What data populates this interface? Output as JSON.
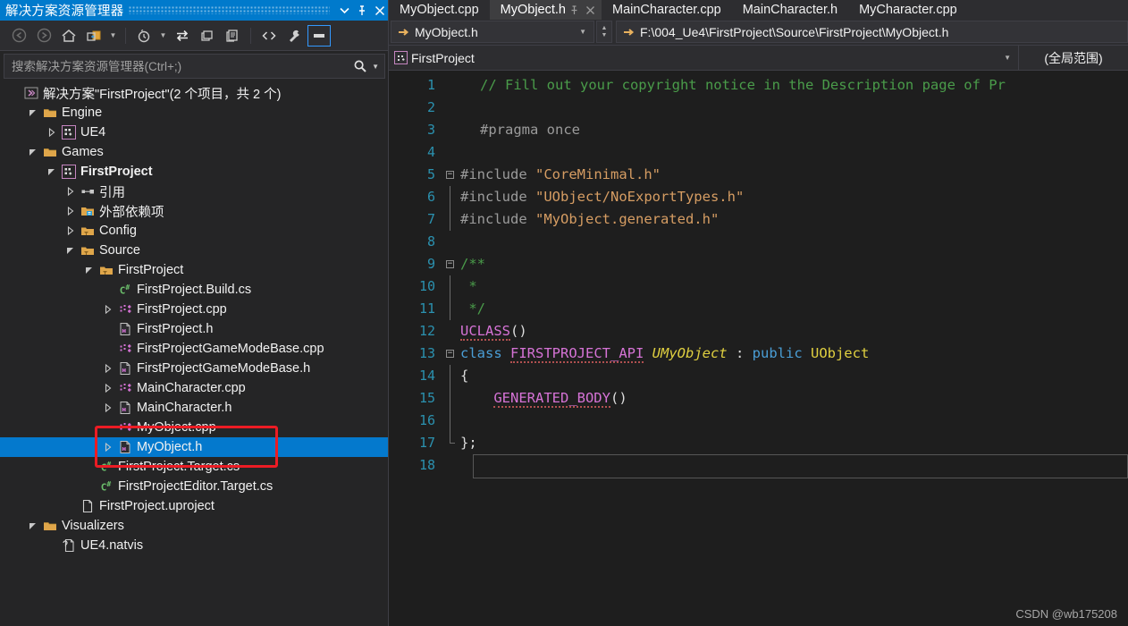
{
  "solution_explorer": {
    "title": "解决方案资源管理器",
    "titlebar_buttons": [
      {
        "name": "dropdown",
        "glyph": "▼"
      },
      {
        "name": "pin",
        "glyph": "⚲"
      },
      {
        "name": "close",
        "glyph": "✕"
      }
    ],
    "toolbar": [
      {
        "name": "back",
        "label": "后退",
        "icon": "back-arrow-icon",
        "disabled": true
      },
      {
        "name": "forward",
        "label": "前进",
        "icon": "forward-arrow-icon",
        "disabled": true
      },
      {
        "name": "home",
        "label": "主页",
        "icon": "home-icon",
        "disabled": false
      },
      {
        "name": "new-folder",
        "label": "新建文件夹",
        "icon": "new-folder-icon",
        "disabled": false
      },
      {
        "name": "pending-changes",
        "label": "挂起的更改筛选器",
        "icon": "clock-filter-icon",
        "disabled": false
      },
      {
        "name": "sync",
        "label": "与活动文档同步",
        "icon": "sync-icon",
        "disabled": false
      },
      {
        "name": "refresh",
        "label": "刷新",
        "icon": "refresh-icon",
        "disabled": false
      },
      {
        "name": "show-all-files",
        "label": "显示所有文件",
        "icon": "show-all-files-icon",
        "disabled": false
      },
      {
        "name": "view-code",
        "label": "查看代码",
        "icon": "view-code-icon",
        "disabled": false
      },
      {
        "name": "properties",
        "label": "属性",
        "icon": "wrench-icon",
        "disabled": false
      },
      {
        "name": "preview-pane",
        "label": "预览选定项",
        "icon": "preview-icon",
        "disabled": false,
        "selected": true
      }
    ],
    "search_placeholder": "搜索解决方案资源管理器(Ctrl+;)",
    "search_value": "",
    "tree": [
      {
        "label": "解决方案\"FirstProject\"(2 个项目，共 2 个)",
        "indent": 0,
        "arrow": "none",
        "icon": "solution-icon",
        "bold": false,
        "selected": false
      },
      {
        "label": "Engine",
        "indent": 1,
        "arrow": "expanded",
        "icon": "folder-icon",
        "bold": false,
        "selected": false
      },
      {
        "label": "UE4",
        "indent": 2,
        "arrow": "collapsed",
        "icon": "cpp-project-icon",
        "bold": false,
        "selected": false
      },
      {
        "label": "Games",
        "indent": 1,
        "arrow": "expanded",
        "icon": "folder-icon",
        "bold": false,
        "selected": false
      },
      {
        "label": "FirstProject",
        "indent": 2,
        "arrow": "expanded",
        "icon": "cpp-project-icon",
        "bold": true,
        "selected": false
      },
      {
        "label": "引用",
        "indent": 3,
        "arrow": "collapsed",
        "icon": "references-icon",
        "bold": false,
        "selected": false
      },
      {
        "label": "外部依赖项",
        "indent": 3,
        "arrow": "collapsed",
        "icon": "ext-deps-icon",
        "bold": false,
        "selected": false
      },
      {
        "label": "Config",
        "indent": 3,
        "arrow": "collapsed",
        "icon": "filter-folder-icon",
        "bold": false,
        "selected": false
      },
      {
        "label": "Source",
        "indent": 3,
        "arrow": "expanded",
        "icon": "filter-folder-icon",
        "bold": false,
        "selected": false
      },
      {
        "label": "FirstProject",
        "indent": 4,
        "arrow": "expanded",
        "icon": "filter-folder-icon",
        "bold": false,
        "selected": false
      },
      {
        "label": "FirstProject.Build.cs",
        "indent": 5,
        "arrow": "none",
        "icon": "csharp-file-icon",
        "bold": false,
        "selected": false
      },
      {
        "label": "FirstProject.cpp",
        "indent": 5,
        "arrow": "collapsed",
        "icon": "cpp-file-icon",
        "bold": false,
        "selected": false
      },
      {
        "label": "FirstProject.h",
        "indent": 5,
        "arrow": "none",
        "icon": "header-file-icon",
        "bold": false,
        "selected": false
      },
      {
        "label": "FirstProjectGameModeBase.cpp",
        "indent": 5,
        "arrow": "none",
        "icon": "cpp-file-icon",
        "bold": false,
        "selected": false
      },
      {
        "label": "FirstProjectGameModeBase.h",
        "indent": 5,
        "arrow": "collapsed",
        "icon": "header-file-icon",
        "bold": false,
        "selected": false
      },
      {
        "label": "MainCharacter.cpp",
        "indent": 5,
        "arrow": "collapsed",
        "icon": "cpp-file-icon",
        "bold": false,
        "selected": false
      },
      {
        "label": "MainCharacter.h",
        "indent": 5,
        "arrow": "collapsed",
        "icon": "header-file-icon",
        "bold": false,
        "selected": false
      },
      {
        "label": "MyObject.cpp",
        "indent": 5,
        "arrow": "none",
        "icon": "cpp-file-icon",
        "bold": false,
        "selected": false
      },
      {
        "label": "MyObject.h",
        "indent": 5,
        "arrow": "collapsed",
        "icon": "header-file-icon",
        "bold": false,
        "selected": true
      },
      {
        "label": "FirstProject.Target.cs",
        "indent": 4,
        "arrow": "none",
        "icon": "csharp-file-icon",
        "bold": false,
        "selected": false
      },
      {
        "label": "FirstProjectEditor.Target.cs",
        "indent": 4,
        "arrow": "none",
        "icon": "csharp-file-icon",
        "bold": false,
        "selected": false
      },
      {
        "label": "FirstProject.uproject",
        "indent": 3,
        "arrow": "none",
        "icon": "generic-file-icon",
        "bold": false,
        "selected": false
      },
      {
        "label": "Visualizers",
        "indent": 1,
        "arrow": "expanded",
        "icon": "folder-icon",
        "bold": false,
        "selected": false
      },
      {
        "label": "UE4.natvis",
        "indent": 2,
        "arrow": "none",
        "icon": "natvis-file-icon",
        "bold": false,
        "selected": false
      }
    ]
  },
  "editor": {
    "tabs": [
      {
        "label": "MyObject.cpp",
        "active": false
      },
      {
        "label": "MyObject.h",
        "active": true
      },
      {
        "label": "MainCharacter.cpp",
        "active": false
      },
      {
        "label": "MainCharacter.h",
        "active": false
      },
      {
        "label": "MyCharacter.cpp",
        "active": false
      }
    ],
    "tab_pin_glyph": "⚲",
    "tab_close_glyph": "✕",
    "nav_file": "MyObject.h",
    "nav_path": "F:\\004_Ue4\\FirstProject\\Source\\FirstProject\\MyObject.h",
    "scope_project": "FirstProject",
    "scope_member": "(全局范围)",
    "gutter_lines": [
      "1",
      "2",
      "3",
      "4",
      "5",
      "6",
      "7",
      "8",
      "9",
      "10",
      "11",
      "12",
      "13",
      "14",
      "15",
      "16",
      "17",
      "18"
    ],
    "code_lines": [
      {
        "n": "1",
        "indent": 1,
        "tokens": [
          {
            "t": "// Fill out your copyright notice in the Description page of Pr",
            "c": "c-com"
          }
        ]
      },
      {
        "n": "2",
        "indent": 1,
        "tokens": []
      },
      {
        "n": "3",
        "indent": 1,
        "tokens": [
          {
            "t": "#pragma once",
            "c": "c-pre"
          }
        ]
      },
      {
        "n": "4",
        "indent": 1,
        "tokens": []
      },
      {
        "n": "5",
        "indent": 0,
        "tokens": [
          {
            "t": "#include ",
            "c": "c-pre"
          },
          {
            "t": "\"CoreMinimal.h\"",
            "c": "c-str"
          }
        ]
      },
      {
        "n": "6",
        "indent": 0,
        "tokens": [
          {
            "t": "#include ",
            "c": "c-pre"
          },
          {
            "t": "\"UObject/NoExportTypes.h\"",
            "c": "c-str"
          }
        ]
      },
      {
        "n": "7",
        "indent": 0,
        "tokens": [
          {
            "t": "#include ",
            "c": "c-pre"
          },
          {
            "t": "\"MyObject.generated.h\"",
            "c": "c-str"
          }
        ]
      },
      {
        "n": "8",
        "indent": 0,
        "tokens": []
      },
      {
        "n": "9",
        "indent": 0,
        "tokens": [
          {
            "t": "/**",
            "c": "c-com"
          }
        ]
      },
      {
        "n": "10",
        "indent": 0,
        "tokens": [
          {
            "t": " *",
            "c": "c-com"
          }
        ]
      },
      {
        "n": "11",
        "indent": 0,
        "tokens": [
          {
            "t": " */",
            "c": "c-com"
          }
        ]
      },
      {
        "n": "12",
        "indent": 0,
        "tokens": [
          {
            "t": "UCLASS",
            "c": "c-mac squig"
          },
          {
            "t": "()",
            "c": "c-plain"
          }
        ]
      },
      {
        "n": "13",
        "indent": 0,
        "tokens": [
          {
            "t": "class ",
            "c": "c-key"
          },
          {
            "t": "FIRSTPROJECT_API",
            "c": "c-mac squig"
          },
          {
            "t": " ",
            "c": "c-plain"
          },
          {
            "t": "UMyObject",
            "c": "c-typ c-ital"
          },
          {
            "t": " : ",
            "c": "c-plain"
          },
          {
            "t": "public ",
            "c": "c-key"
          },
          {
            "t": "UObject",
            "c": "c-typ"
          }
        ]
      },
      {
        "n": "14",
        "indent": 0,
        "tokens": [
          {
            "t": "{",
            "c": "c-plain"
          }
        ]
      },
      {
        "n": "15",
        "indent": 0,
        "tokens": [
          {
            "t": "    ",
            "c": "c-plain"
          },
          {
            "t": "GENERATED_BODY",
            "c": "c-mac squig"
          },
          {
            "t": "()",
            "c": "c-plain"
          }
        ]
      },
      {
        "n": "16",
        "indent": 0,
        "tokens": []
      },
      {
        "n": "17",
        "indent": 0,
        "tokens": [
          {
            "t": "};",
            "c": "c-plain"
          }
        ]
      },
      {
        "n": "18",
        "indent": 0,
        "tokens": []
      }
    ]
  },
  "annotation": {
    "red_box_color": "#ec1c24",
    "highlighted_items": [
      "MyObject.cpp",
      "MyObject.h"
    ]
  },
  "watermark": "CSDN @wb175208",
  "colors": {
    "accent_blue": "#007acc",
    "selection_blue": "#0479cd",
    "panel_bg": "#252526",
    "editor_bg": "#1e1e1e",
    "toolbar_bg": "#2d2d30"
  }
}
